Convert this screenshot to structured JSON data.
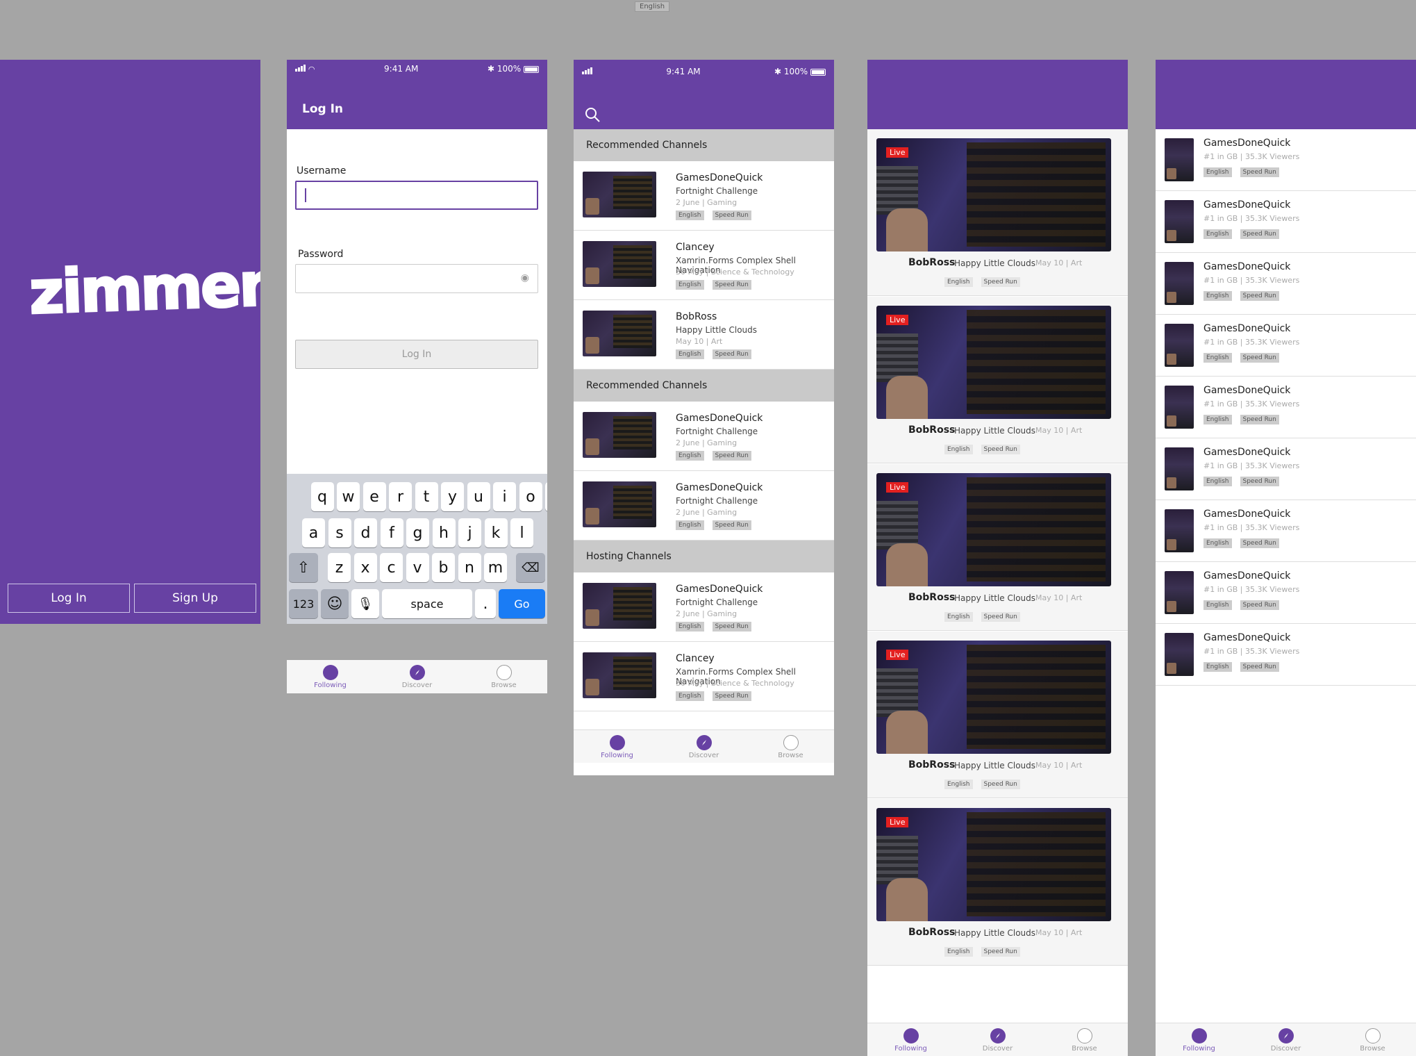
{
  "top_badge": "English",
  "splash": {
    "logo": "zimmer",
    "login_label": "Log In",
    "signup_label": "Sign Up",
    "brand_color": "#6741a3"
  },
  "login": {
    "status_time": "9:41 AM",
    "status_battery": "100%",
    "title": "Log In",
    "username_label": "Username",
    "password_label": "Password",
    "button_label": "Log In",
    "keyboard_row1": [
      "q",
      "w",
      "e",
      "r",
      "t",
      "y",
      "u",
      "i",
      "o",
      "p"
    ],
    "keyboard_row2": [
      "a",
      "s",
      "d",
      "f",
      "g",
      "h",
      "j",
      "k",
      "l"
    ],
    "keyboard_row3": [
      "z",
      "x",
      "c",
      "v",
      "b",
      "n",
      "m"
    ],
    "key_123": "123",
    "key_space": "space",
    "key_dot": ".",
    "key_go": "Go"
  },
  "tabs": [
    {
      "label": "Following",
      "icon": "following-icon"
    },
    {
      "label": "Discover",
      "icon": "compass-icon"
    },
    {
      "label": "Browse",
      "icon": "browse-icon"
    }
  ],
  "channels": {
    "status_time": "9:41 AM",
    "status_battery": "100%",
    "sections": [
      {
        "title": "Recommended Channels",
        "items": [
          {
            "name": "GamesDoneQuick",
            "sub": "Fortnight  Challenge",
            "meta": "2 June | Gaming",
            "tags": [
              "English",
              "Speed Run"
            ]
          },
          {
            "name": "Clancey",
            "sub": "Xamrin.Forms Complex Shell Navigation",
            "meta": "30 May | Science & Technology",
            "tags": [
              "English",
              "Speed Run"
            ]
          },
          {
            "name": "BobRoss",
            "sub": "Happy Little Clouds",
            "meta": "May 10 | Art",
            "tags": [
              "English",
              "Speed Run"
            ]
          }
        ]
      },
      {
        "title": "Recommended Channels",
        "items": [
          {
            "name": "GamesDoneQuick",
            "sub": "Fortnight  Challenge",
            "meta": "2 June | Gaming",
            "tags": [
              "English",
              "Speed Run"
            ]
          },
          {
            "name": "GamesDoneQuick",
            "sub": "Fortnight  Challenge",
            "meta": "2 June | Gaming",
            "tags": [
              "English",
              "Speed Run"
            ]
          }
        ]
      },
      {
        "title": "Hosting Channels",
        "items": [
          {
            "name": "GamesDoneQuick",
            "sub": "Fortnight  Challenge",
            "meta": "2 June | Gaming",
            "tags": [
              "English",
              "Speed Run"
            ]
          },
          {
            "name": "Clancey",
            "sub": "Xamrin.Forms Complex Shell Navigation",
            "meta": "30 May | Science & Technology",
            "tags": [
              "English",
              "Speed Run"
            ]
          }
        ]
      }
    ]
  },
  "streams": [
    {
      "live": "Live",
      "name": "BobRoss",
      "sub": "Happy Little Clouds",
      "meta": "May 10 | Art",
      "tags": [
        "English",
        "Speed Run"
      ]
    },
    {
      "live": "Live",
      "name": "BobRoss",
      "sub": "Happy Little Clouds",
      "meta": "May 10 | Art",
      "tags": [
        "English",
        "Speed Run"
      ]
    },
    {
      "live": "Live",
      "name": "BobRoss",
      "sub": "Happy Little Clouds",
      "meta": "May 10 | Art",
      "tags": [
        "English",
        "Speed Run"
      ]
    },
    {
      "live": "Live",
      "name": "BobRoss",
      "sub": "Happy Little Clouds",
      "meta": "May 10 | Art",
      "tags": [
        "English",
        "Speed Run"
      ]
    },
    {
      "live": "Live",
      "name": "BobRoss",
      "sub": "Happy Little Clouds",
      "meta": "May 10 | Art",
      "tags": [
        "English",
        "Speed Run"
      ]
    }
  ],
  "games": [
    {
      "name": "GamesDoneQuick",
      "sub": "#1 in GB | 35.3K Viewers",
      "tags": [
        "English",
        "Speed Run"
      ]
    },
    {
      "name": "GamesDoneQuick",
      "sub": "#1 in GB | 35.3K Viewers",
      "tags": [
        "English",
        "Speed Run"
      ]
    },
    {
      "name": "GamesDoneQuick",
      "sub": "#1 in GB | 35.3K Viewers",
      "tags": [
        "English",
        "Speed Run"
      ]
    },
    {
      "name": "GamesDoneQuick",
      "sub": "#1 in GB | 35.3K Viewers",
      "tags": [
        "English",
        "Speed Run"
      ]
    },
    {
      "name": "GamesDoneQuick",
      "sub": "#1 in GB | 35.3K Viewers",
      "tags": [
        "English",
        "Speed Run"
      ]
    },
    {
      "name": "GamesDoneQuick",
      "sub": "#1 in GB | 35.3K Viewers",
      "tags": [
        "English",
        "Speed Run"
      ]
    },
    {
      "name": "GamesDoneQuick",
      "sub": "#1 in GB | 35.3K Viewers",
      "tags": [
        "English",
        "Speed Run"
      ]
    },
    {
      "name": "GamesDoneQuick",
      "sub": "#1 in GB | 35.3K Viewers",
      "tags": [
        "English",
        "Speed Run"
      ]
    },
    {
      "name": "GamesDoneQuick",
      "sub": "#1 in GB | 35.3K Viewers",
      "tags": [
        "English",
        "Speed Run"
      ]
    }
  ]
}
